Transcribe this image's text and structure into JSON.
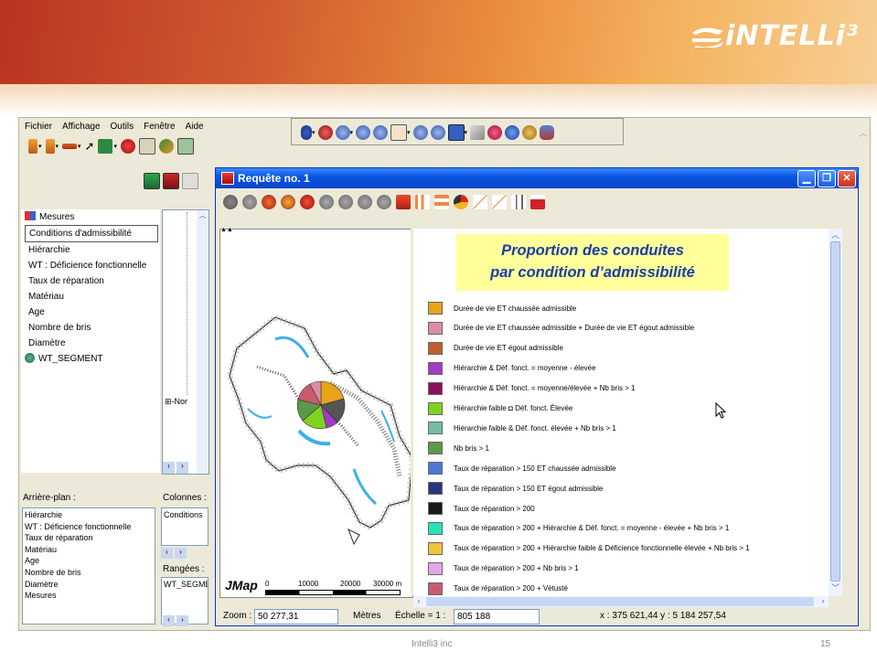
{
  "brand": {
    "logo_text": "iNTELLi³"
  },
  "menu": [
    "Fichier",
    "Affichage",
    "Outils",
    "Fenêtre",
    "Aide"
  ],
  "left_panel": {
    "layers": [
      "Mesures",
      "Conditions d'admissibilité",
      "Hiérarchie",
      "WT : Déficience fonctionnelle",
      "Taux de réparation",
      "Matériau",
      "Age",
      "Nombre de bris",
      "Diamètre",
      "WT_SEGMENT"
    ],
    "selected": "Conditions d'admissibilité",
    "tree_node": "Nor",
    "arriere_plan_label": "Arrière-plan :",
    "colonnes_label": "Colonnes :",
    "ranges_label": "Rangées :",
    "arriere_plan_items": [
      "Hiérarchie",
      "WT : Déficience fonctionnelle",
      "Taux de réparation",
      "Matériau",
      "Age",
      "Nombre de bris",
      "Diamètre",
      "Mesures"
    ],
    "colonnes_value": "Conditions",
    "ranges_value": "WT_SEGME"
  },
  "window": {
    "title": "Requête no. 1",
    "callout_line1": "Proportion des conduites",
    "callout_line2": "par condition d’admissibilité"
  },
  "legend": [
    {
      "label": "Durée de vie ET chaussée admissible",
      "color": "#e8a317"
    },
    {
      "label": "Durée de vie ET chaussée admissible + Durée de vie ET égout admissible",
      "color": "#d98fa3"
    },
    {
      "label": "Durée de vie ET égout admissible",
      "color": "#c0602e"
    },
    {
      "label": "Hiérarchie & Déf. fonct. = moyenne - élevée",
      "color": "#a43bc4"
    },
    {
      "label": "Hiérarchie & Déf. fonct. = moyenne/élevée + Nb bris > 1",
      "color": "#8a1060"
    },
    {
      "label": "Hiérarchie faible ◘ Déf. fonct. Élevée",
      "color": "#7ed321"
    },
    {
      "label": "Hiérarchie faible & Déf. fonct. élevée + Nb bris > 1",
      "color": "#6fbfa2"
    },
    {
      "label": "Nb bris > 1",
      "color": "#5a9a48"
    },
    {
      "label": "Taux de réparation > 150 ET chaussée admissible",
      "color": "#4c78d8"
    },
    {
      "label": "Taux de réparation > 150 ET égout admissible",
      "color": "#2a3878"
    },
    {
      "label": "Taux de réparation > 200",
      "color": "#1a1a1a"
    },
    {
      "label": "Taux de réparation > 200 + Hiérarchie & Déf. fonct. = moyenne - élevée + Nb bris > 1",
      "color": "#27e3b8"
    },
    {
      "label": "Taux de réparation > 200 + Hiérarchie faible & Déficience fonctionnelle élevée + Nb bris > 1",
      "color": "#f2c43a"
    },
    {
      "label": "Taux de réparation > 200 + Nb bris > 1",
      "color": "#e3a6e8"
    },
    {
      "label": "Taux de réparation > 200 + Vétusté",
      "color": "#c95b70"
    }
  ],
  "scale_bar": {
    "brand": "JMap",
    "ticks": [
      "0",
      "10000",
      "20000",
      "30000 m"
    ]
  },
  "status": {
    "zoom_label": "Zoom :",
    "zoom_value": "50 277,31",
    "units": "Mètres",
    "echelle_label": "Échelle = 1 :",
    "echelle_value": "805 188",
    "coords": "x : 375 621,44  y : 5 184 257,54"
  },
  "slide": {
    "footer": "Intelli3 inc",
    "page": "15"
  }
}
